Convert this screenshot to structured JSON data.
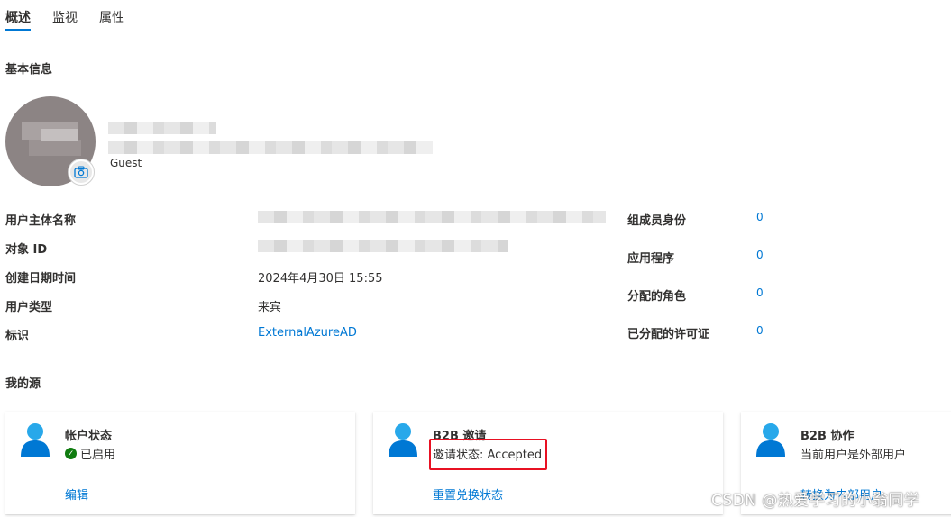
{
  "tabs": [
    {
      "label": "概述",
      "active": true
    },
    {
      "label": "监视",
      "active": false
    },
    {
      "label": "属性",
      "active": false
    }
  ],
  "basic_info": {
    "title": "基本信息",
    "user_type_tag": "Guest"
  },
  "properties": {
    "upn_label": "用户主体名称",
    "object_id_label": "对象 ID",
    "created_label": "创建日期时间",
    "created_value": "2024年4月30日 15:55",
    "user_type_label": "用户类型",
    "user_type_value": "来宾",
    "identity_label": "标识",
    "identity_value": "ExternalAzureAD"
  },
  "stats": {
    "group_label": "组成员身份",
    "group_value": "0",
    "app_label": "应用程序",
    "app_value": "0",
    "role_label": "分配的角色",
    "role_value": "0",
    "license_label": "已分配的许可证",
    "license_value": "0"
  },
  "my_feeds": {
    "title": "我的源",
    "account_card": {
      "title": "帐户状态",
      "status": "已启用",
      "link": "编辑"
    },
    "b2b_invite_card": {
      "title": "B2B 邀请",
      "status": "邀请状态: Accepted",
      "link": "重置兑换状态"
    },
    "b2b_collab_card": {
      "title": "B2B 协作",
      "status": "当前用户是外部用户",
      "link": "转换为内部用户"
    }
  },
  "watermark": "CSDN @热爱学习的小翁同学",
  "colors": {
    "accent": "#0078d4",
    "success": "#107c10",
    "highlight_border": "#e81123"
  }
}
